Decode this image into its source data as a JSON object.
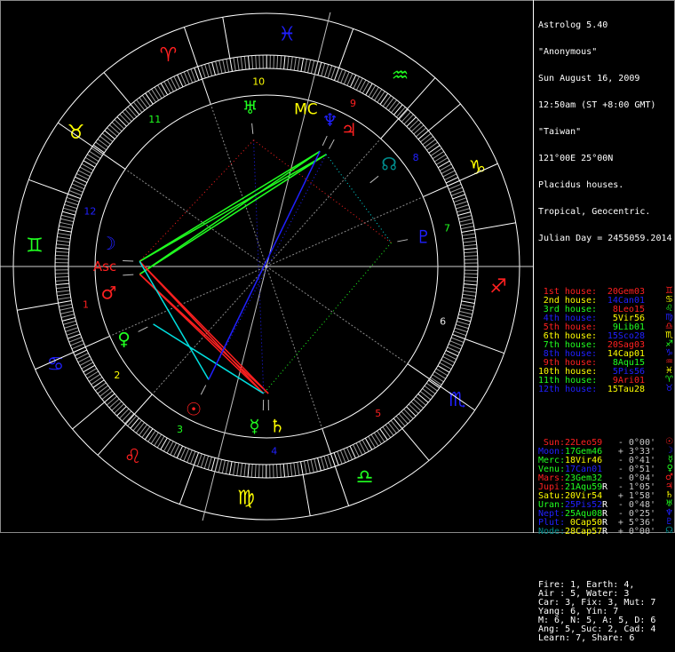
{
  "header": {
    "app": "Astrolog 5.40",
    "name": "\"Anonymous\"",
    "date": "Sun August 16, 2009",
    "time": "12:50am (ST +8:00 GMT)",
    "place": "\"Taiwan\"",
    "coords": "121°00E 25°00N",
    "houses_system": "Placidus houses.",
    "zodiac": "Tropical, Geocentric.",
    "julian": "Julian Day = 2455059.2014"
  },
  "houses": [
    {
      "label": "1st house:",
      "value": "20Gem03",
      "color": "#ff2020",
      "sign_color": "#ff2020",
      "sign": "♊"
    },
    {
      "label": "2nd house:",
      "value": "14Can01",
      "color": "#ffff00",
      "value_color": "#2020ff",
      "sign_color": "#ffff00",
      "sign": "♋"
    },
    {
      "label": "3rd house:",
      "value": "8Leo15",
      "color": "#20ff20",
      "value_color": "#ff2020",
      "sign_color": "#20ff20",
      "sign": "♌"
    },
    {
      "label": "4th house:",
      "value": "5Vir56",
      "color": "#2020ff",
      "value_color": "#ffff00",
      "sign_color": "#2020ff",
      "sign": "♍"
    },
    {
      "label": "5th house:",
      "value": "9Lib01",
      "color": "#ff2020",
      "value_color": "#20ff20",
      "sign_color": "#ff2020",
      "sign": "♎"
    },
    {
      "label": "6th house:",
      "value": "15Sco28",
      "color": "#ffff00",
      "value_color": "#2020ff",
      "sign_color": "#ffff00",
      "sign": "♏"
    },
    {
      "label": "7th house:",
      "value": "20Sag03",
      "color": "#20ff20",
      "value_color": "#ff2020",
      "sign_color": "#20ff20",
      "sign": "♐"
    },
    {
      "label": "8th house:",
      "value": "14Cap01",
      "color": "#2020ff",
      "value_color": "#ffff00",
      "sign_color": "#2020ff",
      "sign": "♑"
    },
    {
      "label": "9th house:",
      "value": "8Aqu15",
      "color": "#ff2020",
      "value_color": "#20ff20",
      "sign_color": "#ff2020",
      "sign": "♒"
    },
    {
      "label": "10th house:",
      "value": "5Pis56",
      "color": "#ffff00",
      "value_color": "#2020ff",
      "sign_color": "#ffff00",
      "sign": "♓"
    },
    {
      "label": "11th house:",
      "value": "9Ari01",
      "color": "#20ff20",
      "value_color": "#ff2020",
      "sign_color": "#20ff20",
      "sign": "♈"
    },
    {
      "label": "12th house:",
      "value": "15Tau28",
      "color": "#2020ff",
      "value_color": "#ffff00",
      "sign_color": "#2020ff",
      "sign": "♉"
    }
  ],
  "planets": [
    {
      "key": "sun",
      "label": "Sun:",
      "value": "22Leo59",
      "retro": "",
      "diff": "- 0°00'",
      "color": "#ff2020",
      "value_color": "#ff2020",
      "glyph": "☉"
    },
    {
      "key": "moon",
      "label": "Moon:",
      "value": "17Gem46",
      "retro": "",
      "diff": "+ 3°33'",
      "color": "#2020ff",
      "value_color": "#20ff20",
      "glyph": "☽"
    },
    {
      "key": "merc",
      "label": "Merc:",
      "value": "18Vir46",
      "retro": "",
      "diff": "- 0°41'",
      "color": "#20ff20",
      "value_color": "#ffff00",
      "glyph": "☿"
    },
    {
      "key": "venu",
      "label": "Venu:",
      "value": "17Can01",
      "retro": "",
      "diff": "- 0°51'",
      "color": "#20ff20",
      "value_color": "#2020ff",
      "glyph": "♀"
    },
    {
      "key": "mars",
      "label": "Mars:",
      "value": "23Gem32",
      "retro": "",
      "diff": "- 0°04'",
      "color": "#ff2020",
      "value_color": "#20ff20",
      "glyph": "♂"
    },
    {
      "key": "jupi",
      "label": "Jupi:",
      "value": "21Aqu59",
      "retro": "R",
      "diff": "- 1°05'",
      "color": "#ff2020",
      "value_color": "#20ff20",
      "glyph": "♃"
    },
    {
      "key": "satu",
      "label": "Satu:",
      "value": "20Vir54",
      "retro": "",
      "diff": "+ 1°58'",
      "color": "#ffff00",
      "value_color": "#ffff00",
      "glyph": "♄"
    },
    {
      "key": "uran",
      "label": "Uran:",
      "value": "25Pis52",
      "retro": "R",
      "diff": "- 0°48'",
      "color": "#20ff20",
      "value_color": "#2020ff",
      "glyph": "♅"
    },
    {
      "key": "nept",
      "label": "Nept:",
      "value": "25Aqu08",
      "retro": "R",
      "diff": "- 0°25'",
      "color": "#2020ff",
      "value_color": "#20ff20",
      "glyph": "♆"
    },
    {
      "key": "plut",
      "label": "Plut:",
      "value": "0Cap50",
      "retro": "R",
      "diff": "+ 5°36'",
      "color": "#2020ff",
      "value_color": "#ffff00",
      "glyph": "♇"
    },
    {
      "key": "node",
      "label": "Node:",
      "value": "28Cap57",
      "retro": "R",
      "diff": "+ 0°00'",
      "color": "#008c8c",
      "value_color": "#ffff00",
      "glyph": "☊"
    }
  ],
  "summary": [
    "Fire: 1, Earth: 4,",
    "Air : 5, Water: 3",
    "Car: 3, Fix: 3, Mut: 7",
    "Yang: 6, Yin: 7",
    "M: 6, N: 5, A: 5, D: 6",
    "Ang: 5, Suc: 2, Cad: 4",
    "Learn: 7, Share: 6"
  ],
  "chart": {
    "asc_label": "Asc",
    "mc_label": "MC",
    "house_numbers": [
      "1",
      "2",
      "3",
      "4",
      "5",
      "6",
      "7",
      "8",
      "9",
      "10",
      "11",
      "12"
    ],
    "house_number_colors": [
      "#ff2020",
      "#ffff00",
      "#20ff20",
      "#2020ff",
      "#ff2020",
      "#e8e8e8",
      "#20ff20",
      "#2020ff",
      "#ff2020",
      "#ffff00",
      "#20ff20",
      "#2020ff"
    ],
    "signs": [
      "♈",
      "♉",
      "♊",
      "♋",
      "♌",
      "♍",
      "♎",
      "♏",
      "♐",
      "♑",
      "♒",
      "♓"
    ],
    "sign_colors": [
      "#ff2020",
      "#ffff00",
      "#20ff20",
      "#2020ff",
      "#ff2020",
      "#ffff00",
      "#20ff20",
      "#2020ff",
      "#ff2020",
      "#ffff00",
      "#20ff20",
      "#2020ff"
    ],
    "aspects": [
      {
        "a": "moon",
        "b": "jupi",
        "color": "#20ff20",
        "dotted": false
      },
      {
        "a": "moon",
        "b": "nept",
        "color": "#20ff20",
        "dotted": false
      },
      {
        "a": "mars",
        "b": "jupi",
        "color": "#20ff20",
        "dotted": false
      },
      {
        "a": "mars",
        "b": "nept",
        "color": "#20ff20",
        "dotted": false
      },
      {
        "a": "moon",
        "b": "merc",
        "color": "#ff2020",
        "dotted": false
      },
      {
        "a": "moon",
        "b": "satu",
        "color": "#ff2020",
        "dotted": false
      },
      {
        "a": "mars",
        "b": "merc",
        "color": "#ff2020",
        "dotted": false
      },
      {
        "a": "mars",
        "b": "satu",
        "color": "#ff2020",
        "dotted": false
      },
      {
        "a": "moon",
        "b": "sun",
        "color": "#00e0e0",
        "dotted": false
      },
      {
        "a": "venu",
        "b": "merc",
        "color": "#00e0e0",
        "dotted": false
      },
      {
        "a": "sun",
        "b": "nept",
        "color": "#2020ff",
        "dotted": false
      },
      {
        "a": "sun",
        "b": "jupi",
        "color": "#2020ff",
        "dotted": true
      },
      {
        "a": "uran",
        "b": "merc",
        "color": "#2020ff",
        "dotted": true
      },
      {
        "a": "uran",
        "b": "moon",
        "color": "#ff2020",
        "dotted": true
      },
      {
        "a": "uran",
        "b": "plut",
        "color": "#ff2020",
        "dotted": true
      },
      {
        "a": "jupi",
        "b": "plut",
        "color": "#00e0e0",
        "dotted": true
      },
      {
        "a": "plut",
        "b": "merc",
        "color": "#20ff20",
        "dotted": true
      }
    ]
  }
}
